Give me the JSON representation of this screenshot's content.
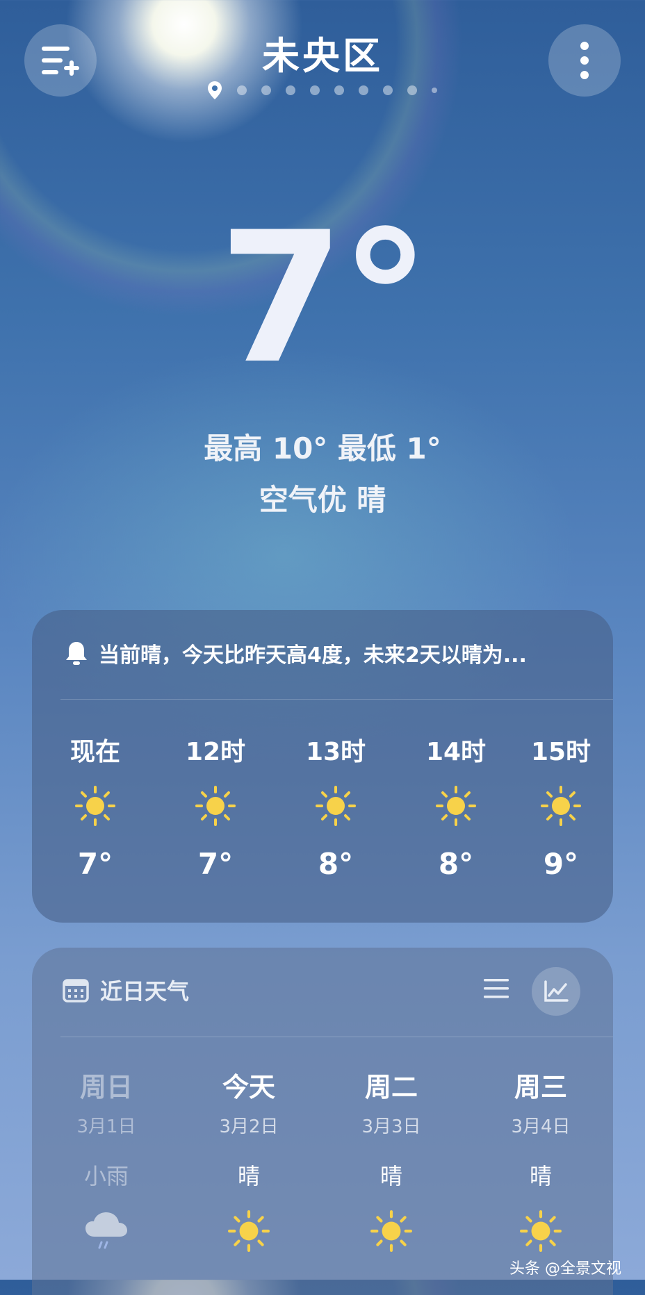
{
  "header": {
    "location": "未央区",
    "menu_icon": "add-city-menu-icon",
    "more_icon": "more-vertical-icon",
    "page_count": 10
  },
  "current": {
    "temperature": "7°",
    "hi_lo": "最高 10° 最低 1°",
    "air_condition": "空气优  晴"
  },
  "hourly_card": {
    "alert_icon": "bell-icon",
    "alert_text": "当前晴，今天比昨天高4度，未来2天以晴为...",
    "hours": [
      {
        "time": "现在",
        "icon": "sun-icon",
        "temp": "7°"
      },
      {
        "time": "12时",
        "icon": "sun-icon",
        "temp": "7°"
      },
      {
        "time": "13时",
        "icon": "sun-icon",
        "temp": "8°"
      },
      {
        "time": "14时",
        "icon": "sun-icon",
        "temp": "8°"
      },
      {
        "time": "15时",
        "icon": "sun-icon",
        "temp": "9°"
      }
    ]
  },
  "daily_card": {
    "title": "近日天气",
    "title_icon": "calendar-icon",
    "view_icons": [
      "list-view-icon",
      "chart-view-icon"
    ],
    "days": [
      {
        "name": "周日",
        "date": "3月1日",
        "condition": "小雨",
        "icon": "rain-cloud-icon"
      },
      {
        "name": "今天",
        "date": "3月2日",
        "condition": "晴",
        "icon": "sun-icon"
      },
      {
        "name": "周二",
        "date": "3月3日",
        "condition": "晴",
        "icon": "sun-icon"
      },
      {
        "name": "周三",
        "date": "3月4日",
        "condition": "晴",
        "icon": "sun-icon"
      }
    ]
  },
  "watermark": "头条 @全景文视",
  "colors": {
    "sun": "#f7d24a",
    "card": "#465f87",
    "sky_top": "#2f5e9a",
    "sky_bottom": "#8ca9d8"
  }
}
